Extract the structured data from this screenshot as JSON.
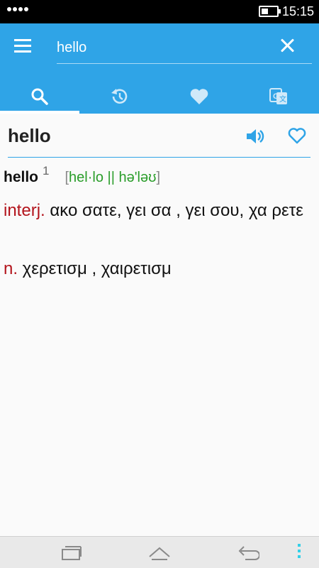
{
  "status_bar": {
    "time": "15:15"
  },
  "search": {
    "query": "hello"
  },
  "tabs": [
    {
      "icon": "search-icon"
    },
    {
      "icon": "history-icon"
    },
    {
      "icon": "favorites-heart-icon"
    },
    {
      "icon": "google-translate-icon"
    }
  ],
  "colors": {
    "primary": "#2fa4e7",
    "pos": "#b3141c",
    "ipa": "#2a9d2a"
  },
  "entry": {
    "header_word": "hello",
    "headword": "hello",
    "homonym": "1",
    "pron_open": "[",
    "pronunciation": "hel·lo || hə'ləʊ",
    "pron_close": "]",
    "senses": [
      {
        "pos": "interj.",
        "text": " ακο σατε, γει  σα    , γει σου, χα ρετε"
      },
      {
        "pos": "n.",
        "text": " χερετισμ      , χαιρετισμ"
      }
    ]
  }
}
